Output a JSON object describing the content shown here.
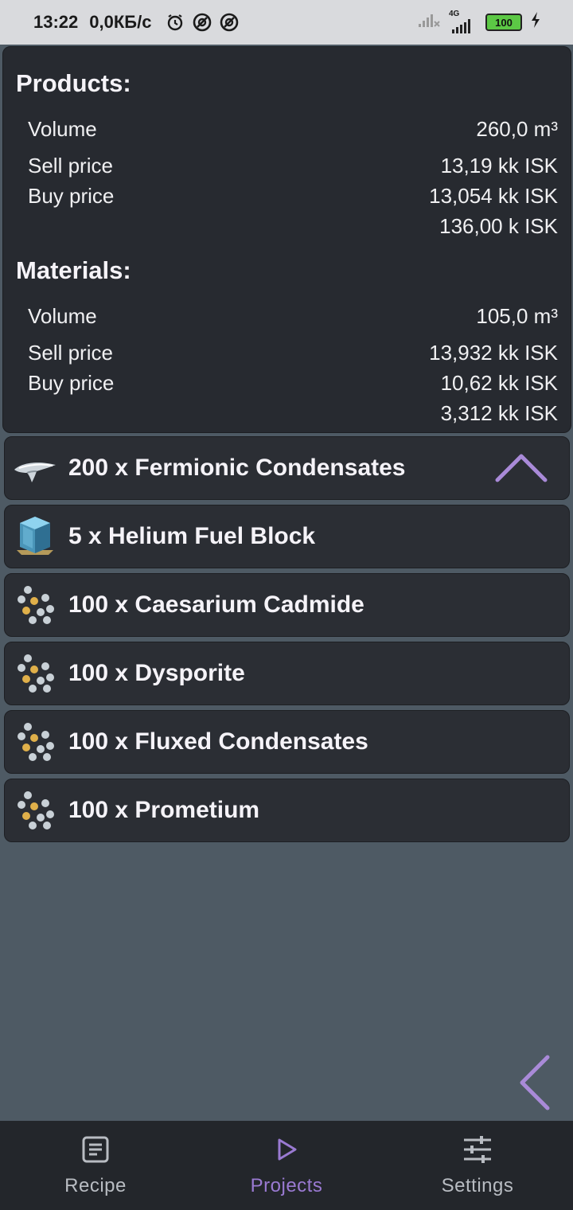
{
  "status_bar": {
    "time": "13:22",
    "speed": "0,0КБ/с",
    "network": "4G",
    "battery": "100"
  },
  "products": {
    "title": "Products:",
    "volume_label": "Volume",
    "volume_value": "260,0 m³",
    "sell_label": "Sell price",
    "sell_value": "13,19 kk ISK",
    "buy_label": "Buy price",
    "buy_value": "13,054 kk ISK",
    "extra_value": "136,00 k ISK"
  },
  "materials": {
    "title": "Materials:",
    "volume_label": "Volume",
    "volume_value": "105,0 m³",
    "sell_label": "Sell price",
    "sell_value": "13,932 kk ISK",
    "buy_label": "Buy price",
    "buy_value": "10,62 kk ISK",
    "extra_value": "3,312 kk ISK"
  },
  "items": [
    {
      "label": "200 x Fermionic Condensates",
      "icon": "fermionic-condensates-icon"
    },
    {
      "label": "5 x Helium Fuel Block",
      "icon": "helium-fuel-block-icon"
    },
    {
      "label": "100 x Caesarium Cadmide",
      "icon": "molecule-icon"
    },
    {
      "label": "100 x Dysporite",
      "icon": "molecule-icon"
    },
    {
      "label": "100 x Fluxed Condensates",
      "icon": "molecule-icon"
    },
    {
      "label": "100 x Prometium",
      "icon": "molecule-icon"
    }
  ],
  "nav": {
    "recipe": "Recipe",
    "projects": "Projects",
    "settings": "Settings",
    "active": "Projects"
  },
  "colors": {
    "accent": "#9a7ad2",
    "background": "#4e5a64",
    "card": "#272a30"
  }
}
